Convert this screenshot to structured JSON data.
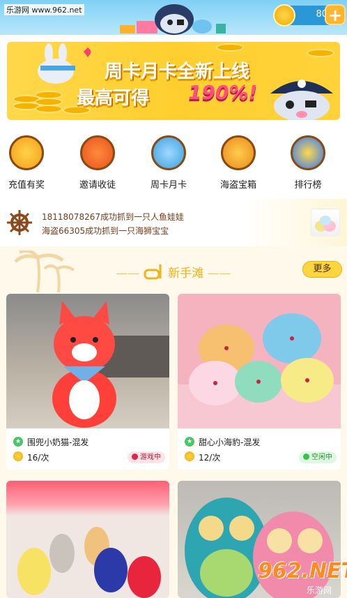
{
  "header": {
    "watermark": "乐游网 www.962.net",
    "coins": "80"
  },
  "banner": {
    "line1": "周卡月卡全新上线",
    "line2": "最高可得",
    "highlight": "190%!"
  },
  "menu": [
    {
      "label": "充值有奖"
    },
    {
      "label": "邀请收徒"
    },
    {
      "label": "周卡月卡"
    },
    {
      "label": "海盗宝箱"
    },
    {
      "label": "排行榜"
    }
  ],
  "ticker": {
    "line1": "18118078267成功抓到一只人鱼娃娃",
    "line2": "海盗66305成功抓到一只海狮宝宝"
  },
  "section": {
    "title": "新手滩",
    "more": "更多"
  },
  "cards": [
    {
      "name": "围兜小奶猫-混发",
      "price": "16/次",
      "status": "游戏中",
      "status_color": "#e0244a"
    },
    {
      "name": "甜心小海豹-混发",
      "price": "12/次",
      "status": "空闲中",
      "status_color": "#37c24b"
    }
  ],
  "footer_watermark": {
    "brand": "962.NET",
    "sub": "乐游网"
  }
}
